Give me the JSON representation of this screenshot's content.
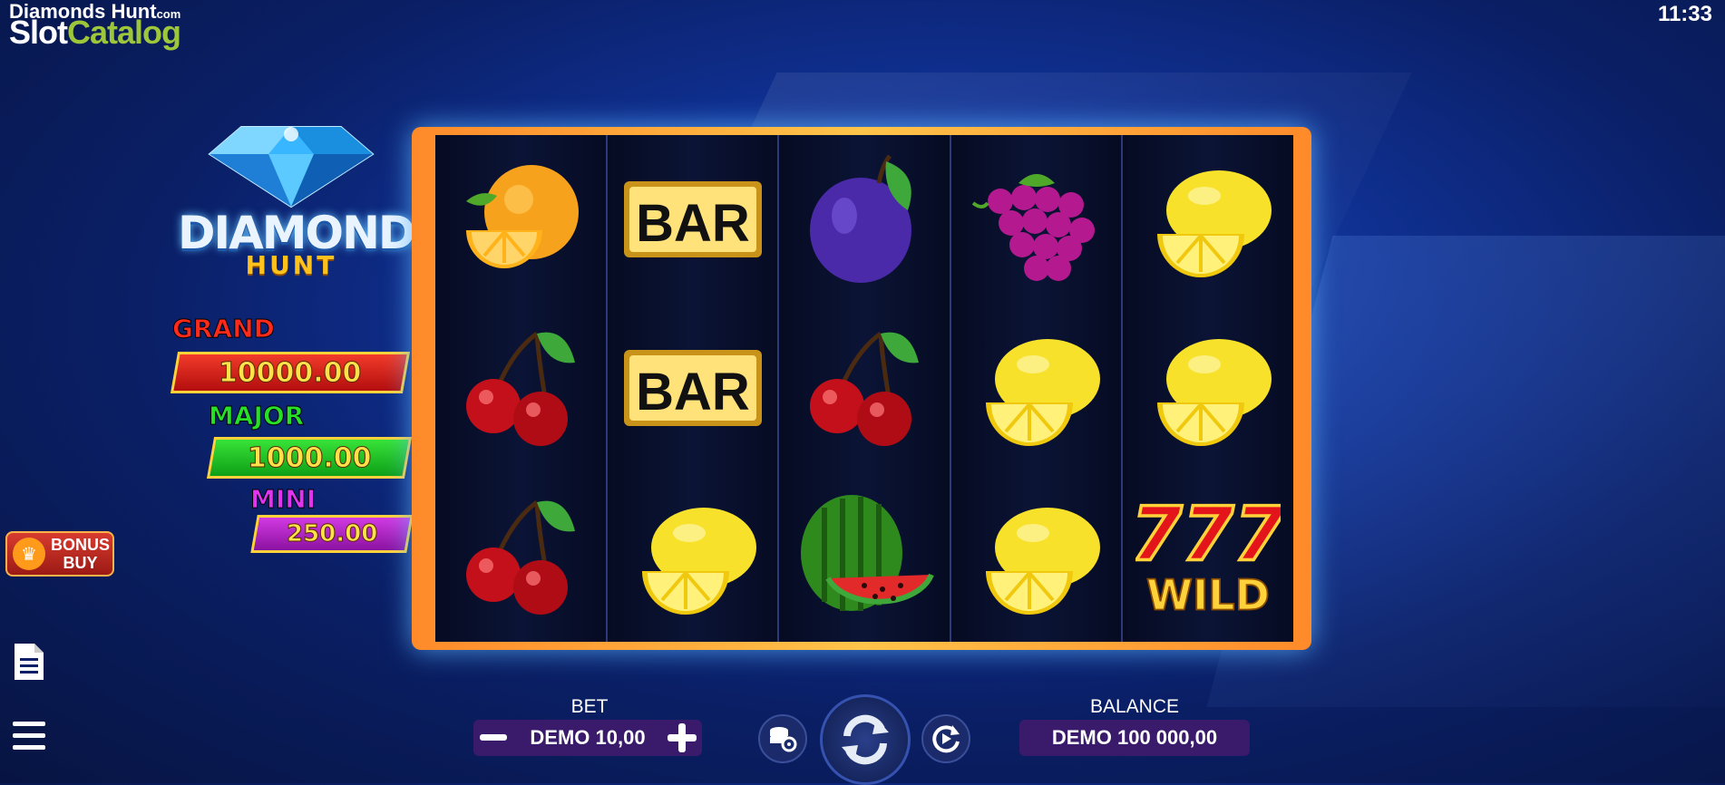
{
  "watermark": {
    "title": "Diamonds Hunt",
    "suffix": "com",
    "brand_a": "Slot",
    "brand_b": "Catalog"
  },
  "clock": "11:33",
  "game_logo": {
    "line1": "DIAMONDS",
    "line2": "HUNT"
  },
  "jackpots": [
    {
      "label": "GRAND",
      "value": "10000.00"
    },
    {
      "label": "MAJOR",
      "value": "1000.00"
    },
    {
      "label": "MINI",
      "value": "250.00"
    }
  ],
  "bonus_buy": {
    "line1": "BONUS",
    "line2": "BUY"
  },
  "reels": [
    [
      "orange",
      "cherry",
      "cherry"
    ],
    [
      "bar",
      "bar",
      "lemon"
    ],
    [
      "plum",
      "cherry",
      "watermelon"
    ],
    [
      "grapes",
      "lemon",
      "lemon"
    ],
    [
      "lemon",
      "lemon",
      "wild"
    ]
  ],
  "symbol_text": {
    "bar": "BAR",
    "wild_top": "777",
    "wild_bottom": "WILD"
  },
  "bet": {
    "label": "BET",
    "value": "DEMO 10,00"
  },
  "balance": {
    "label": "BALANCE",
    "value": "DEMO 100 000,00"
  },
  "icons": [
    "document-icon",
    "menu-icon",
    "minus-icon",
    "plus-icon",
    "coins-settings-icon",
    "spin-icon",
    "autoplay-icon",
    "crown-icon"
  ],
  "colors": {
    "grand": "#e02020",
    "major": "#19c21f",
    "mini": "#c22ad6",
    "frame": "#ffb43a",
    "jackpot_text": "#ffe14a"
  }
}
